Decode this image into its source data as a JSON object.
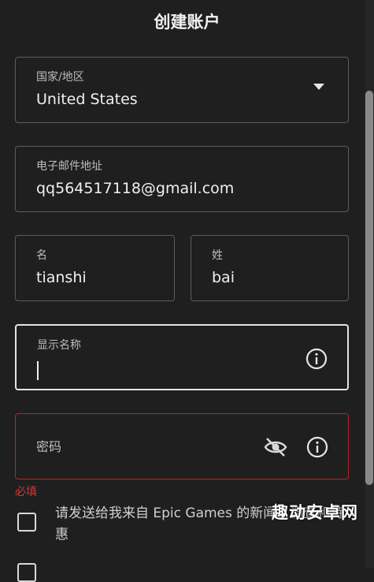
{
  "page": {
    "title": "创建账户"
  },
  "country": {
    "label": "国家/地区",
    "value": "United States"
  },
  "email": {
    "label": "电子邮件地址",
    "value": "qq564517118@gmail.com"
  },
  "first_name": {
    "label": "名",
    "value": "tianshi"
  },
  "last_name": {
    "label": "姓",
    "value": "bai"
  },
  "display_name": {
    "label": "显示名称",
    "value": ""
  },
  "password": {
    "label": "密码",
    "required_text": "必填"
  },
  "consent": {
    "text": "请发送给我来自 Epic Games 的新闻、调查和特惠"
  },
  "watermark": {
    "text": "趣动安卓网"
  },
  "icons": {
    "dropdown": "chevron-down-icon",
    "info": "info-icon",
    "hide_password": "eye-off-icon"
  },
  "colors": {
    "background": "#1f1f1f",
    "error": "#d13a3a",
    "border": "#5c5c5c"
  }
}
